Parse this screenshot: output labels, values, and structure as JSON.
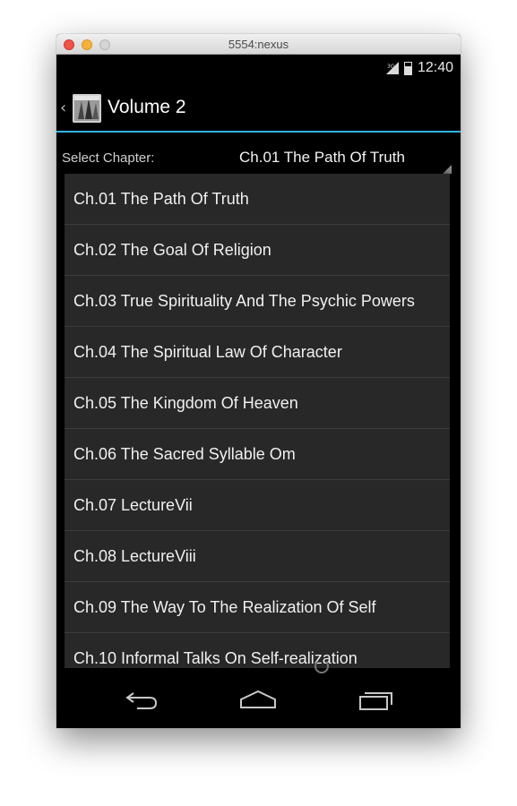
{
  "window": {
    "title": "5554:nexus"
  },
  "status_bar": {
    "network": "3G",
    "time": "12:40"
  },
  "action_bar": {
    "up_glyph": "‹",
    "title": "Volume 2",
    "icon": "book-cover-icon"
  },
  "chapter_select": {
    "label": "Select Chapter:",
    "selected": "Ch.01 The Path Of Truth"
  },
  "chapters": [
    "Ch.01 The Path Of Truth",
    "Ch.02 The Goal Of Religion",
    "Ch.03 True Spirituality And The Psychic Powers",
    "Ch.04 The Spiritual Law Of Character",
    "Ch.05 The Kingdom Of Heaven",
    "Ch.06 The Sacred Syllable Om",
    "Ch.07 LectureVii",
    "Ch.08 LectureViii",
    "Ch.09 The Way To The Realization Of Self",
    "Ch.10 Informal Talks On Self-realization"
  ],
  "nav_bar": {
    "back": "back-icon",
    "home": "home-icon",
    "recents": "recent-apps-icon"
  },
  "colors": {
    "accent": "#33b5e5",
    "dropdown_bg": "#282828",
    "background": "#000000"
  }
}
